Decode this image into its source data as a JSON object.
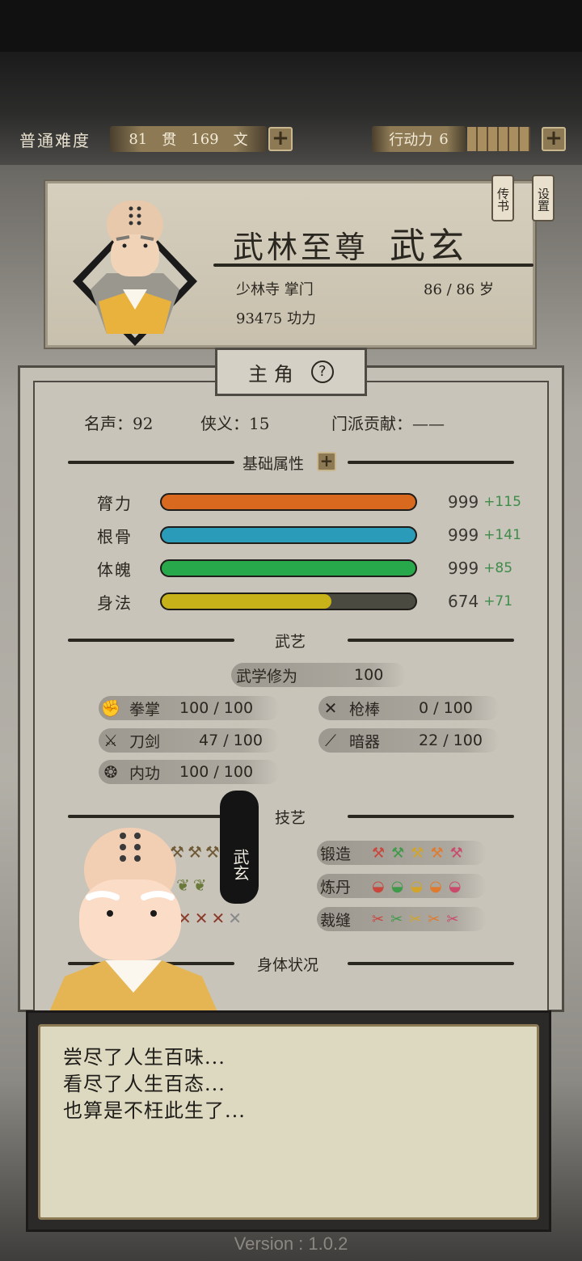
{
  "hud": {
    "difficulty": "普通难度",
    "money_guan": "81",
    "money_guan_unit": "贯",
    "money_wen": "169",
    "money_wen_unit": "文",
    "action_label": "行动力",
    "action_value": "6",
    "action_segments_filled": 6,
    "plus_symbol": "+"
  },
  "profile": {
    "title": "武林至尊",
    "name": "武玄",
    "sect": "少林寺 掌门",
    "age": "86 / 86 岁",
    "power": "93475 功力",
    "btn_letters": "传书",
    "btn_settings": "设置"
  },
  "sheet": {
    "tab_title": "主 角",
    "help_symbol": "?",
    "fame": "名声：92",
    "chivalry": "侠义：15",
    "contribution": "门派贡献：——",
    "basic_title": "基础属性",
    "attributes": [
      {
        "name": "膂力",
        "value": "999",
        "bonus": "+115",
        "fill": 1.0,
        "color": "#d8691f"
      },
      {
        "name": "根骨",
        "value": "999",
        "bonus": "+141",
        "fill": 1.0,
        "color": "#2a9bb8"
      },
      {
        "name": "体魄",
        "value": "999",
        "bonus": "+85",
        "fill": 1.0,
        "color": "#27a84a"
      },
      {
        "name": "身法",
        "value": "674",
        "bonus": "+71",
        "fill": 0.67,
        "color": "#c8b21a"
      }
    ],
    "martial_title": "武艺",
    "martial_cultivation_label": "武学修为",
    "martial_cultivation_value": "100",
    "skills": [
      {
        "name": "拳掌",
        "value": "100 / 100",
        "icon": "fist-icon"
      },
      {
        "name": "枪棒",
        "value": "0 / 100",
        "icon": "spear-icon"
      },
      {
        "name": "刀剑",
        "value": "47 / 100",
        "icon": "swords-icon"
      },
      {
        "name": "暗器",
        "value": "22 / 100",
        "icon": "dart-icon"
      },
      {
        "name": "内功",
        "value": "100 / 100",
        "icon": "qi-icon"
      }
    ],
    "crafts_title": "技艺",
    "crafts": [
      {
        "name": "锻造",
        "icon": "anvil-icon",
        "glyph": "⚒",
        "count": 5
      },
      {
        "name": "炼丹",
        "icon": "bowl-icon",
        "glyph": "◒",
        "count": 5
      },
      {
        "name": "裁缝",
        "icon": "needle-icon",
        "glyph": "✂",
        "count": 5
      }
    ],
    "body_title": "身体状况"
  },
  "speaker": {
    "name": "武玄"
  },
  "dialog": {
    "line1": "尝尽了人生百味...",
    "line2": "看尽了人生百态...",
    "line3": "也算是不枉此生了..."
  },
  "footer": {
    "version": "Version : 1.0.2"
  },
  "colors": {
    "accent_gold": "#8d7a55",
    "bonus_green": "#3f8c4a"
  }
}
